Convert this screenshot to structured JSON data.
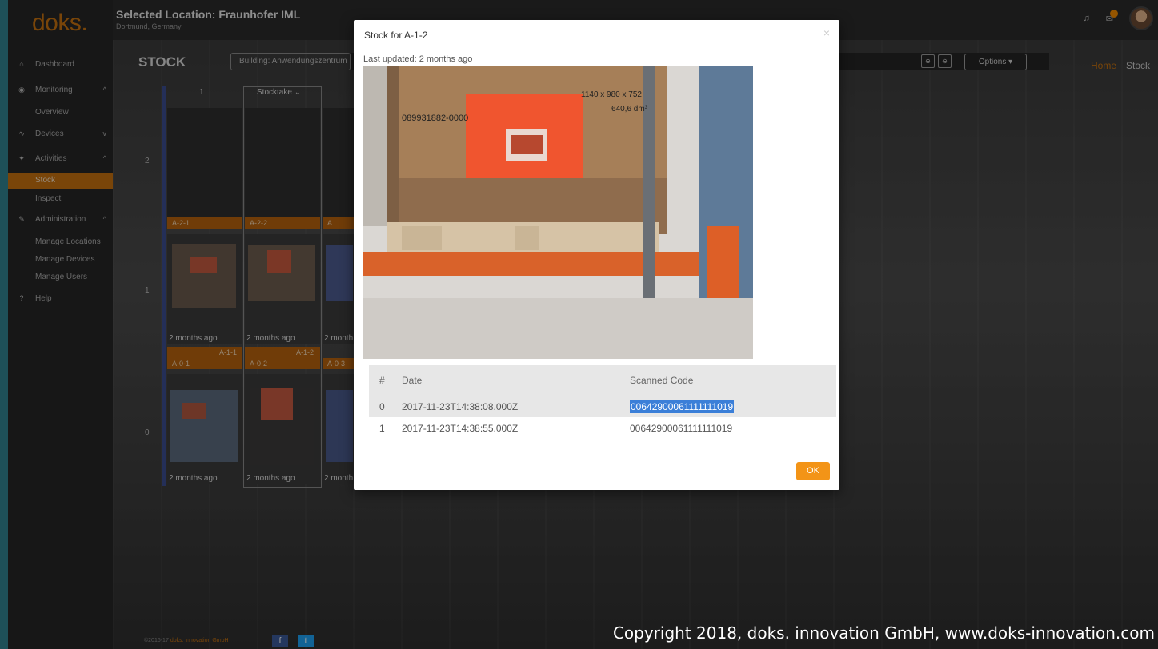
{
  "app": {
    "logo": "doks.",
    "location_title": "Selected Location: Fraunhofer IML",
    "location_sub": "Dortmund, Germany"
  },
  "sidebar": {
    "dashboard": "Dashboard",
    "monitoring": "Monitoring",
    "overview": "Overview",
    "devices": "Devices",
    "activities": "Activities",
    "stock": "Stock",
    "inspect": "Inspect",
    "administration": "Administration",
    "manage_locations": "Manage Locations",
    "manage_devices": "Manage Devices",
    "manage_users": "Manage Users",
    "help": "Help"
  },
  "header": {
    "page_title": "STOCK",
    "building": "Building: Anwendungszentrum",
    "options": "Options",
    "breadcrumb_home": "Home",
    "breadcrumb_stock": "Stock"
  },
  "rack": {
    "column_1": "1",
    "stocktake": "Stocktake",
    "row_2": "2",
    "row_1": "1",
    "row_0": "0",
    "tags_row2": [
      "A-2-1",
      "A-2-2",
      "A"
    ],
    "tags_row1_top": [
      "A-1-1",
      "A-1-2"
    ],
    "tags_row1_bottom": [
      "A-0-1",
      "A-0-2",
      "A-0-3"
    ],
    "times": [
      "2 months ago",
      "2 months ago",
      "2 month",
      "2 months ago",
      "2 months ago",
      "2 month"
    ]
  },
  "modal": {
    "title": "Stock for A-1-2",
    "close": "×",
    "updated": "Last updated: 2 months ago",
    "photo_text": {
      "code": "089931882-0000",
      "dims": "1140 x 980 x 752",
      "volume": "640,6 dm³"
    },
    "table": {
      "headers": [
        "#",
        "Date",
        "Scanned Code"
      ],
      "rows": [
        {
          "num": "0",
          "date": "2017-11-23T14:38:08.000Z",
          "code": "00642900061111111019"
        },
        {
          "num": "1",
          "date": "2017-11-23T14:38:55.000Z",
          "code": "00642900061111111019"
        }
      ]
    },
    "ok": "OK"
  },
  "footer": {
    "copyright_small": "©2016-17",
    "company_small": "doks. innovation GmbH",
    "watermark": "Copyright 2018, doks. innovation GmbH, www.doks-innovation.com"
  },
  "colors": {
    "accent": "#c3700f",
    "ok_button": "#f39417",
    "selection": "#3b7fd8",
    "rack_bar": "#3a4d8f"
  },
  "icons": {
    "dashboard": "home-icon",
    "monitoring": "monitor-icon",
    "devices": "pulse-icon",
    "activities": "pin-icon",
    "administration": "wrench-icon",
    "help": "question-icon",
    "notifications": "bell-icon",
    "messages": "mail-icon"
  }
}
